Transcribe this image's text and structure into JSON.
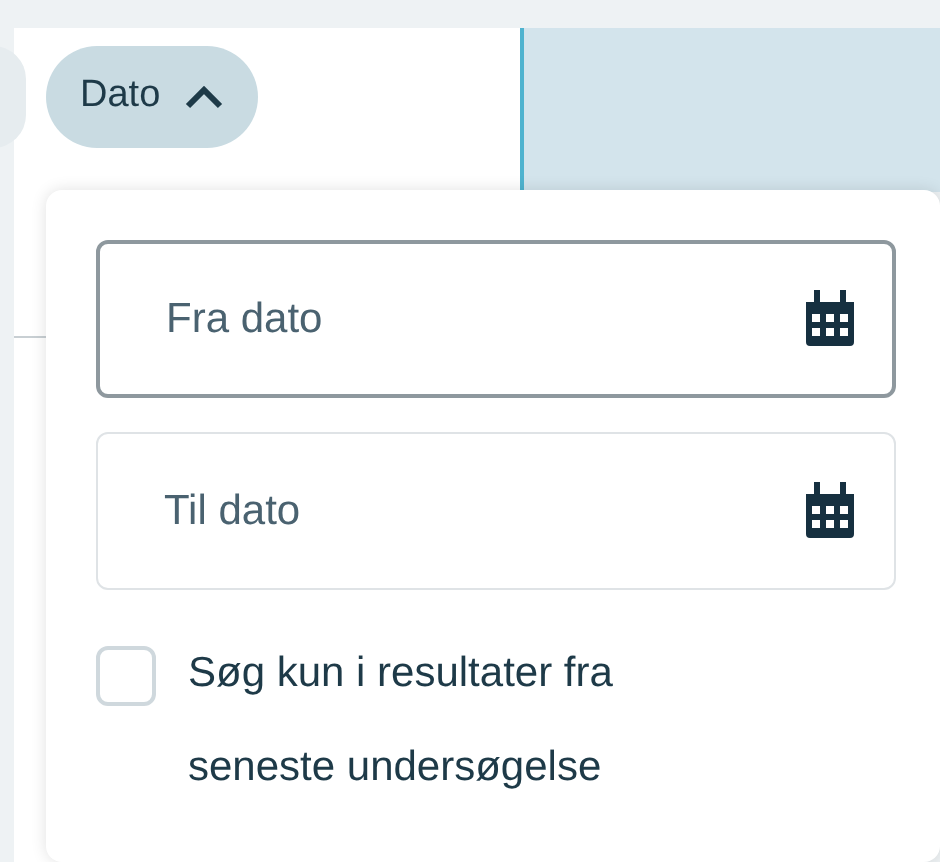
{
  "filter_chip": {
    "label": "Dato",
    "expanded": true
  },
  "date_fields": [
    {
      "placeholder": "Fra dato",
      "focused": true
    },
    {
      "placeholder": "Til dato",
      "focused": false
    }
  ],
  "checkbox": {
    "label": "Søg kun i resultater fra seneste undersøgelse",
    "checked": false
  }
}
